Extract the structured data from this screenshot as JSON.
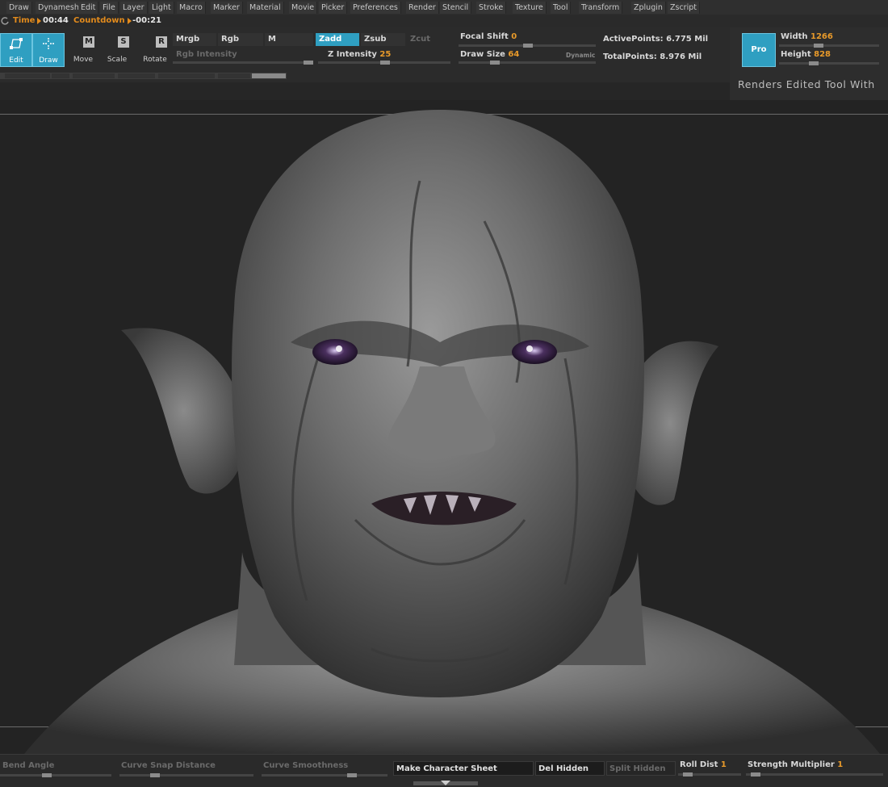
{
  "menu": [
    "Draw",
    "Dynamesh",
    "Edit",
    "File",
    "Layer",
    "Light",
    "Macro",
    "Marker",
    "Material",
    "Movie",
    "Picker",
    "Preferences",
    "Render",
    "Stencil",
    "Stroke",
    "Texture",
    "Tool",
    "Transform",
    "Zplugin",
    "Zscript"
  ],
  "timer": {
    "time_label": "Time",
    "time_value": "00:44",
    "countdown_label": "Countdown",
    "countdown_value": "-00:21"
  },
  "tools": {
    "edit": "Edit",
    "draw": "Draw",
    "move": "Move",
    "scale": "Scale",
    "rotate": "Rotate",
    "move_key": "M",
    "scale_key": "S",
    "rotate_key": "R"
  },
  "color_mode": {
    "mrgb": "Mrgb",
    "rgb": "Rgb",
    "m": "M",
    "rgb_intensity": "Rgb Intensity"
  },
  "z_mode": {
    "zadd": "Zadd",
    "zsub": "Zsub",
    "zcut": "Zcut",
    "z_intensity_label": "Z Intensity",
    "z_intensity_value": "25"
  },
  "brush": {
    "focal_shift_label": "Focal Shift",
    "focal_shift_value": "0",
    "draw_size_label": "Draw Size",
    "draw_size_value": "64",
    "dynamic_label": "Dynamic"
  },
  "stats": {
    "active_points": "ActivePoints: 6.775 Mil",
    "total_points": "TotalPoints: 8.976 Mil"
  },
  "render": {
    "pro_label": "Pro",
    "width_label": "Width",
    "width_value": "1266",
    "height_label": "Height",
    "height_value": "828",
    "caption": "Renders Edited Tool With"
  },
  "bottom": {
    "bend_angle": "Bend Angle",
    "curve_snap": "Curve Snap Distance",
    "curve_smooth": "Curve Smoothness",
    "make_sheet": "Make Character Sheet",
    "del_hidden": "Del Hidden",
    "split_hidden": "Split Hidden",
    "roll_dist_label": "Roll Dist",
    "roll_dist_value": "1",
    "strength_label": "Strength Multiplier",
    "strength_value": "1"
  },
  "colors": {
    "accent": "#2f9fc1",
    "orange": "#e38b1c",
    "background": "#262626"
  }
}
